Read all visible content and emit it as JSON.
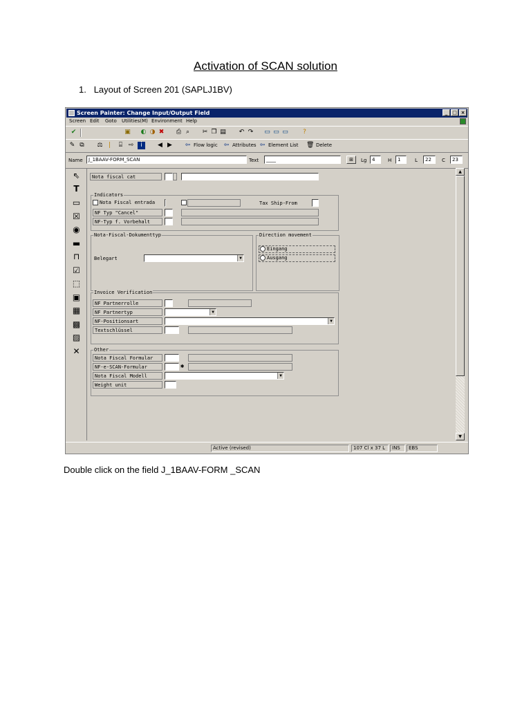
{
  "document": {
    "title": "Activation of SCAN solution",
    "step_number": "1.",
    "step_text": "Layout of Screen 201 (SAPLJ1BV)",
    "instruction": "Double click on the field J_1BAAV-FORM _SCAN"
  },
  "window": {
    "title": "Screen Painter: Change Input/Output Field",
    "controls": {
      "minimize": "_",
      "restore": "□",
      "close": "×"
    }
  },
  "menubar": [
    "Screen",
    "Edit",
    "Goto",
    "Utilities(M)",
    "Environment",
    "Help"
  ],
  "toolbar2_labels": {
    "flow_logic": "Flow logic",
    "attributes": "Attributes",
    "element_list": "Element List",
    "delete": "Delete"
  },
  "namebar": {
    "name_label": "Name",
    "name_value": "J_1BAAV-FORM_SCAN",
    "text_label": "Text",
    "text_value": "____",
    "lg_label": "Lg",
    "lg_value": "4",
    "h_label": "H",
    "h_value": "1",
    "l_label": "L",
    "l_value": "22",
    "c_label": "C",
    "c_value": "23"
  },
  "canvas": {
    "nota_fiscal_cat": "Nota fiscal cat",
    "indicators": {
      "title": "Indicators",
      "nota_fiscal_entrada": "Nota Fiscal entrada",
      "tax_ship_from": "Tax Ship-From",
      "nf_typ_cancel": "NF Typ \"Cancel\"",
      "nf_typ_vorbehalt": "NF-Typ f. Vorbehalt"
    },
    "dokumenttyp": {
      "title": "Nota-Fiscal-Dokumenttyp",
      "belegart": "Belegart"
    },
    "direction": {
      "title": "Direction movement",
      "eingang": "Eingang",
      "ausgang": "Ausgang"
    },
    "invoice": {
      "title": "Invoice Verification",
      "nf_partnerrolle": "NF Partnerrolle",
      "nf_partnertyp": "NF Partnertyp",
      "nf_positionsart": "NF-Positionsart",
      "textschluessel": "Textschlüssel"
    },
    "other": {
      "title": "Other",
      "nota_fiscal_formular": "Nota Fiscal Formular",
      "nf_e_scan_formular": "NF-e-SCAN-Formular",
      "nota_fiscal_modell": "Nota Fiscal Modell",
      "weight_unit": "Weight unit"
    }
  },
  "statusbar": {
    "status": "Active (revised)",
    "position": "107 Cl x 37 L",
    "mode": "INS",
    "server": "EBS"
  }
}
